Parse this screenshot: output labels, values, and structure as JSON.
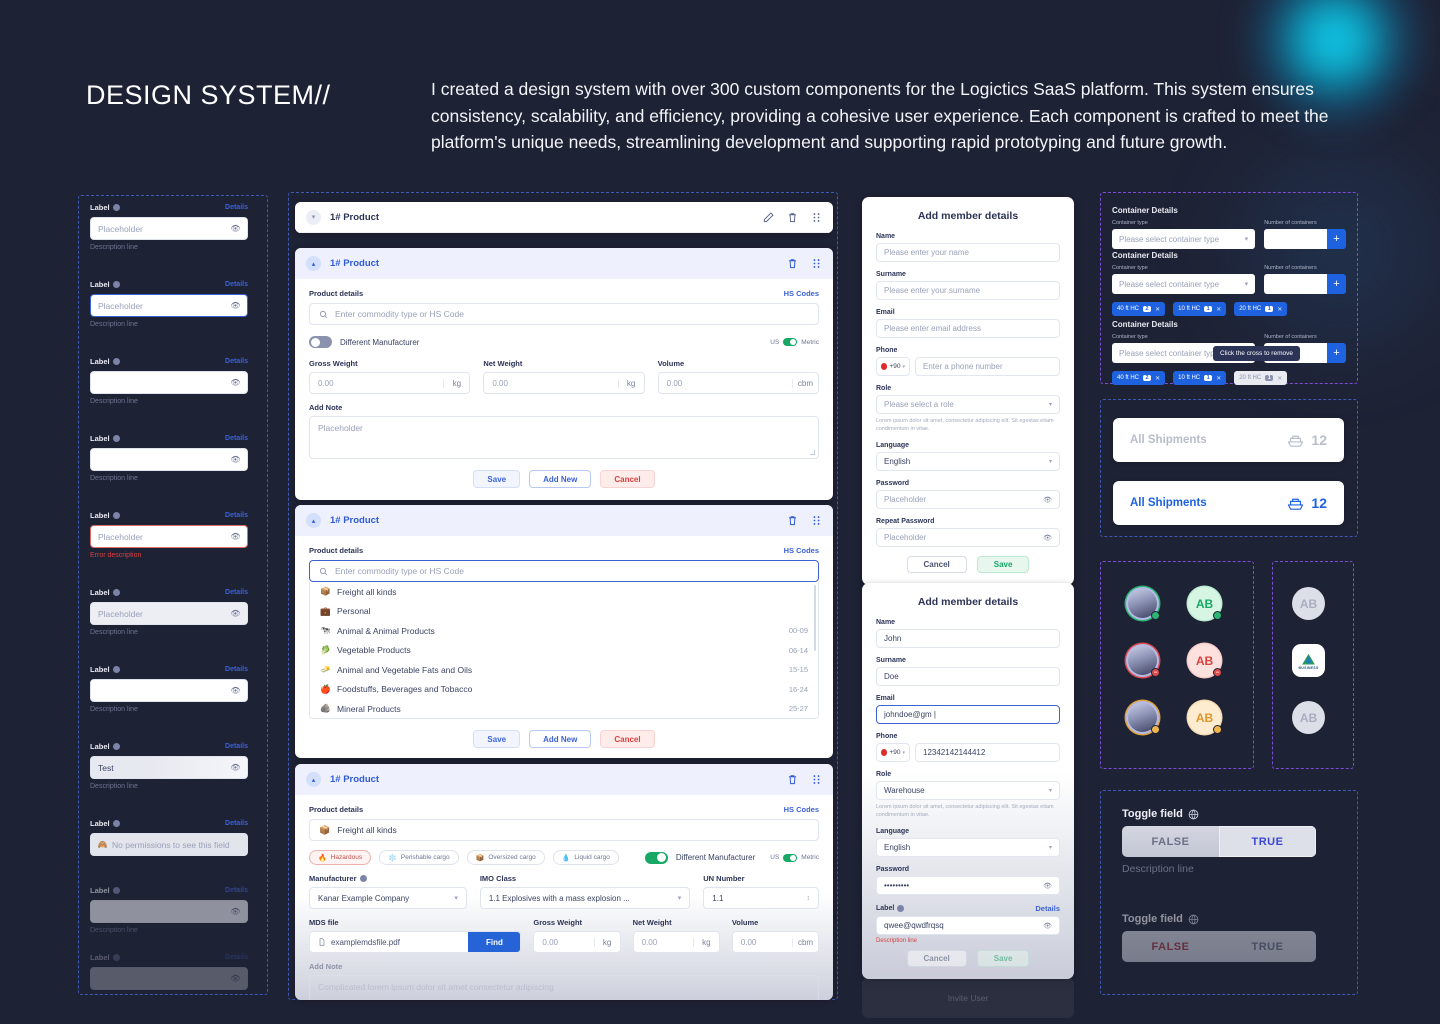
{
  "header": {
    "title": "DESIGN SYSTEM//",
    "intro": "I created a design system with over 300 custom components for the Logictics SaaS platform. This system ensures consistency, scalability, and efficiency, providing a cohesive user experience. Each component is crafted to meet the platform's unique needs, streamlining development and supporting rapid prototyping and future growth."
  },
  "form_fields": {
    "label": "Label",
    "details": "Details",
    "description": "Description line",
    "error_description": "Error description",
    "items": [
      {
        "placeholder": "Placeholder",
        "state": "default",
        "desc": "Description line"
      },
      {
        "placeholder": "Placeholder",
        "state": "focus",
        "desc": "Description line"
      },
      {
        "placeholder": "",
        "state": "empty",
        "desc": "Description line"
      },
      {
        "placeholder": "",
        "state": "hover",
        "desc": "Description line"
      },
      {
        "placeholder": "Placeholder",
        "state": "error",
        "desc": "Error description"
      },
      {
        "placeholder": "Placeholder",
        "state": "disabled",
        "desc": "Description line"
      },
      {
        "placeholder": "",
        "state": "empty",
        "desc": "Description line"
      },
      {
        "placeholder": "Test",
        "state": "prefill",
        "desc": "Description line"
      },
      {
        "placeholder": "No permissions to see this field",
        "state": "noperm",
        "desc": ""
      },
      {
        "placeholder": "",
        "state": "faded-error",
        "desc": "Description line"
      },
      {
        "placeholder": "",
        "state": "faded",
        "desc": ""
      }
    ]
  },
  "product_cards": {
    "title": "1# Product",
    "product_details_label": "Product details",
    "hs_codes_link": "HS Codes",
    "search_placeholder": "Enter commodity type or HS Code",
    "different_manufacturer": "Different Manufacturer",
    "unit_us": "US",
    "unit_metric": "Metric",
    "gross_weight": "Gross Weight",
    "net_weight": "Net Weight",
    "volume": "Volume",
    "weight_value": "0.00",
    "unit_kg": "kg",
    "unit_cbm": "cbm",
    "add_note": "Add Note",
    "note_placeholder": "Placeholder",
    "note_filled": "Complicated lorem ipsum dolor sit amet consectetur adipiscing",
    "btn_save": "Save",
    "btn_add_new": "Add New",
    "btn_cancel": "Cancel",
    "dropdown_items": [
      {
        "emoji": "📦",
        "name": "Freight all kinds",
        "code": ""
      },
      {
        "emoji": "💼",
        "name": "Personal",
        "code": ""
      },
      {
        "emoji": "🐄",
        "name": "Animal & Animal Products",
        "code": "00-09"
      },
      {
        "emoji": "🥬",
        "name": "Vegetable  Products",
        "code": "06-14"
      },
      {
        "emoji": "🧈",
        "name": "Animal and Vegetable Fats and Oils",
        "code": "15-15"
      },
      {
        "emoji": "🍎",
        "name": "Foodstuffs, Beverages and Tobacco",
        "code": "16-24"
      },
      {
        "emoji": "🪨",
        "name": "Mineral Products",
        "code": "25-27"
      }
    ],
    "selected_commodity": "Freight all kinds",
    "selected_emoji": "📦",
    "cargo_tags": [
      {
        "emoji": "🔥",
        "label": "Hazardous",
        "active": true
      },
      {
        "emoji": "❄️",
        "label": "Perishable cargo",
        "active": false
      },
      {
        "emoji": "📦",
        "label": "Oversized cargo",
        "active": false
      },
      {
        "emoji": "💧",
        "label": "Liquid cargo",
        "active": false
      }
    ],
    "manufacturer_label": "Manufacturer",
    "manufacturer_value": "Kanar Example Company",
    "imo_class_label": "IMO Class",
    "imo_class_value": "1.1 Explosives with a mass explosion ...",
    "un_number_label": "UN Number",
    "un_number_value": "1.1",
    "mds_file_label": "MDS file",
    "mds_file_value": "examplemdsfile.pdf",
    "find_button": "Find"
  },
  "member_form_empty": {
    "title": "Add member details",
    "name_label": "Name",
    "name_placeholder": "Please enter your name",
    "surname_label": "Surname",
    "surname_placeholder": "Please enter your surname",
    "email_label": "Email",
    "email_placeholder": "Please enter email address",
    "phone_label": "Phone",
    "country_code": "+90",
    "phone_placeholder": "Enter a phone number",
    "role_label": "Role",
    "role_placeholder": "Please select a role",
    "role_help": "Lorem ipsum dolor sit amet, consectetur adipiscing elit. Sit egestas etiam condimentum in vitae.",
    "language_label": "Language",
    "language_value": "English",
    "password_label": "Password",
    "password_placeholder": "Placeholder",
    "repeat_password_label": "Repeat Password",
    "repeat_password_placeholder": "Placeholder",
    "btn_cancel": "Cancel",
    "btn_save": "Save"
  },
  "member_form_filled": {
    "title": "Add member details",
    "name_label": "Name",
    "name_value": "John",
    "surname_label": "Surname",
    "surname_value": "Doe",
    "email_label": "Email",
    "email_value": "johndoe@gm |",
    "phone_label": "Phone",
    "country_code": "+90",
    "phone_value": "12342142144412",
    "role_label": "Role",
    "role_value": "Warehouse",
    "role_help": "Lorem ipsum dolor sit amet, consectetur adipiscing elit. Sit egestas etiam condimentum in vitae.",
    "language_label": "Language",
    "language_value": "English",
    "password_label": "Password",
    "password_value": "•••••••••",
    "extra_label": "Label",
    "extra_details": "Details",
    "extra_value": "qwee@qwdfrqsq",
    "extra_desc": "Description line",
    "btn_cancel": "Cancel",
    "btn_save": "Save"
  },
  "invite_card": {
    "label": "Invite User"
  },
  "container_details": {
    "section_title": "Container Details",
    "type_label": "Container type",
    "type_placeholder": "Please select container type",
    "number_label": "Number of containers",
    "plus": "+",
    "tooltip": "Click the cross to remove",
    "tags": [
      {
        "label": "40 ft HC",
        "count": "2"
      },
      {
        "label": "10 ft HC",
        "count": "1"
      },
      {
        "label": "20 ft HC",
        "count": "1"
      }
    ]
  },
  "shipments": {
    "label": "All Shipments",
    "count": "12",
    "icon": "ship-icon"
  },
  "avatars": {
    "initials": "AB",
    "business_label": "BUSINESS",
    "statuses": [
      "online",
      "busy",
      "away"
    ]
  },
  "toggle_fields": [
    {
      "label": "Toggle field",
      "false_label": "FALSE",
      "true_label": "TRUE",
      "selected": "TRUE",
      "desc": "Description line",
      "state": "active"
    },
    {
      "label": "Toggle field",
      "false_label": "FALSE",
      "true_label": "TRUE",
      "selected": "FALSE",
      "desc": "",
      "state": "disabled"
    }
  ],
  "colors": {
    "background": "#1e2235",
    "accent_blue": "#2f5ad6",
    "brand_blue": "#1f62e0",
    "danger": "#d9413f",
    "success": "#17a866",
    "glow_cyan": "#12d4f5"
  }
}
